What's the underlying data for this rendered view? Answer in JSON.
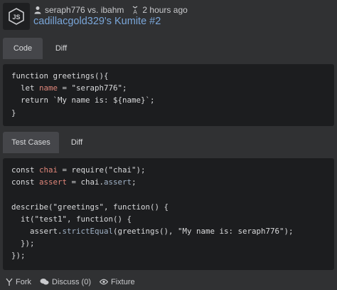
{
  "header": {
    "language_icon": "nodejs-icon",
    "users": "seraph776 vs. ibahm",
    "time": "2 hours ago",
    "title": "cadillacgold329's Kumite #2"
  },
  "solution_tabs": [
    {
      "label": "Code",
      "active": true
    },
    {
      "label": "Diff",
      "active": false
    }
  ],
  "code_lines": [
    "function greetings(){",
    "  let name = \"seraph776\";",
    "  return `My name is: ${name}`;",
    "}"
  ],
  "test_tabs": [
    {
      "label": "Test Cases",
      "active": true
    },
    {
      "label": "Diff",
      "active": false
    }
  ],
  "test_lines": [
    "const chai = require(\"chai\");",
    "const assert = chai.assert;",
    "",
    "describe(\"greetings\", function() {",
    "  it(\"test1\", function() {",
    "    assert.strictEqual(greetings(), \"My name is: seraph776\");",
    "  });",
    "});"
  ],
  "footer": {
    "fork": "Fork",
    "discuss": "Discuss (0)",
    "fixture": "Fixture"
  }
}
